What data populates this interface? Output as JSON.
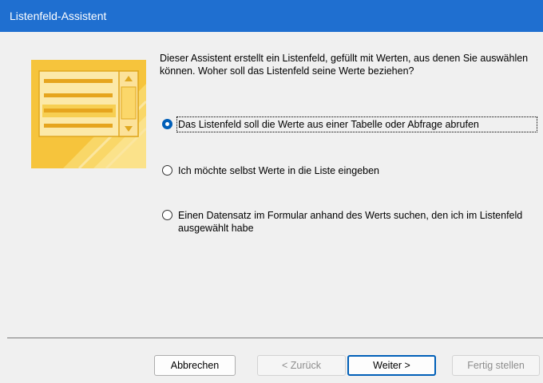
{
  "window": {
    "title": "Listenfeld-Assistent"
  },
  "description": "Dieser Assistent erstellt ein Listenfeld, gefüllt mit Werten, aus denen Sie auswählen können. Woher soll das Listenfeld seine Werte beziehen?",
  "options": [
    {
      "label": "Das Listenfeld soll die Werte aus einer Tabelle oder Abfrage abrufen",
      "mnemonic": "D",
      "selected": true
    },
    {
      "label": "Ich möchte selbst Werte in die Liste eingeben",
      "mnemonic": "I",
      "selected": false
    },
    {
      "label": "Einen Datensatz im Formular anhand des Werts suchen, den ich im Listenfeld ausgewählt habe",
      "mnemonic": "E",
      "selected": false
    }
  ],
  "buttons": {
    "cancel": "Abbrechen",
    "back": "< Zurück",
    "next": "Weiter >",
    "finish": "Fertig stellen"
  },
  "colors": {
    "titlebar": "#1f6fd0",
    "accent": "#005fb8",
    "illustration": "#f5c842"
  },
  "icons": {
    "illustration": "listbox-illustration-icon"
  }
}
